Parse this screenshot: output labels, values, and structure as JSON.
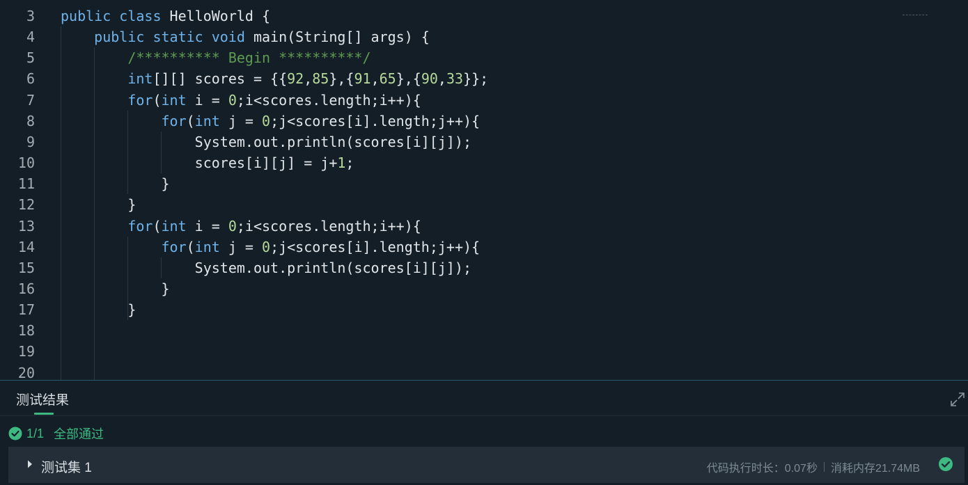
{
  "editor": {
    "lines": [
      {
        "number": "3",
        "segments": [
          {
            "k": "kw",
            "t": "public"
          },
          {
            "k": "",
            "t": " "
          },
          {
            "k": "kw",
            "t": "class"
          },
          {
            "k": "",
            "t": " HelloWorld {"
          }
        ]
      },
      {
        "number": "4",
        "segments": [
          {
            "k": "",
            "t": "    "
          },
          {
            "k": "kw",
            "t": "public"
          },
          {
            "k": "",
            "t": " "
          },
          {
            "k": "kw",
            "t": "static"
          },
          {
            "k": "",
            "t": " "
          },
          {
            "k": "kw",
            "t": "void"
          },
          {
            "k": "",
            "t": " main(String[] args) {"
          }
        ]
      },
      {
        "number": "5",
        "segments": [
          {
            "k": "",
            "t": "        "
          },
          {
            "k": "cm",
            "t": "/********** Begin **********/"
          }
        ]
      },
      {
        "number": "6",
        "segments": [
          {
            "k": "",
            "t": "        "
          },
          {
            "k": "kw",
            "t": "int"
          },
          {
            "k": "",
            "t": "[][] scores = {{"
          },
          {
            "k": "num",
            "t": "92"
          },
          {
            "k": "",
            "t": ","
          },
          {
            "k": "num",
            "t": "85"
          },
          {
            "k": "",
            "t": "},{"
          },
          {
            "k": "num",
            "t": "91"
          },
          {
            "k": "",
            "t": ","
          },
          {
            "k": "num",
            "t": "65"
          },
          {
            "k": "",
            "t": "},{"
          },
          {
            "k": "num",
            "t": "90"
          },
          {
            "k": "",
            "t": ","
          },
          {
            "k": "num",
            "t": "33"
          },
          {
            "k": "",
            "t": "}};"
          }
        ]
      },
      {
        "number": "7",
        "segments": [
          {
            "k": "",
            "t": "        "
          },
          {
            "k": "kw",
            "t": "for"
          },
          {
            "k": "",
            "t": "("
          },
          {
            "k": "kw",
            "t": "int"
          },
          {
            "k": "",
            "t": " i = "
          },
          {
            "k": "num",
            "t": "0"
          },
          {
            "k": "",
            "t": ";i<scores.length;i++){"
          }
        ]
      },
      {
        "number": "8",
        "segments": [
          {
            "k": "",
            "t": "            "
          },
          {
            "k": "kw",
            "t": "for"
          },
          {
            "k": "",
            "t": "("
          },
          {
            "k": "kw",
            "t": "int"
          },
          {
            "k": "",
            "t": " j = "
          },
          {
            "k": "num",
            "t": "0"
          },
          {
            "k": "",
            "t": ";j<scores[i].length;j++){"
          }
        ]
      },
      {
        "number": "9",
        "segments": [
          {
            "k": "",
            "t": "                System.out.println(scores[i][j]);"
          }
        ]
      },
      {
        "number": "10",
        "segments": [
          {
            "k": "",
            "t": "                scores[i][j] = j+"
          },
          {
            "k": "num",
            "t": "1"
          },
          {
            "k": "",
            "t": ";"
          }
        ]
      },
      {
        "number": "11",
        "segments": [
          {
            "k": "",
            "t": "            }"
          }
        ]
      },
      {
        "number": "12",
        "segments": [
          {
            "k": "",
            "t": "        }"
          }
        ]
      },
      {
        "number": "13",
        "segments": [
          {
            "k": "",
            "t": "        "
          },
          {
            "k": "kw",
            "t": "for"
          },
          {
            "k": "",
            "t": "("
          },
          {
            "k": "kw",
            "t": "int"
          },
          {
            "k": "",
            "t": " i = "
          },
          {
            "k": "num",
            "t": "0"
          },
          {
            "k": "",
            "t": ";i<scores.length;i++){"
          }
        ]
      },
      {
        "number": "14",
        "segments": [
          {
            "k": "",
            "t": "            "
          },
          {
            "k": "kw",
            "t": "for"
          },
          {
            "k": "",
            "t": "("
          },
          {
            "k": "kw",
            "t": "int"
          },
          {
            "k": "",
            "t": " j = "
          },
          {
            "k": "num",
            "t": "0"
          },
          {
            "k": "",
            "t": ";j<scores[i].length;j++){"
          }
        ]
      },
      {
        "number": "15",
        "segments": [
          {
            "k": "",
            "t": "                System.out.println(scores[i][j]);"
          }
        ]
      },
      {
        "number": "16",
        "segments": [
          {
            "k": "",
            "t": "            }"
          }
        ]
      },
      {
        "number": "17",
        "segments": [
          {
            "k": "",
            "t": "        }"
          }
        ]
      },
      {
        "number": "18",
        "segments": []
      },
      {
        "number": "19",
        "segments": []
      },
      {
        "number": "20",
        "segments": []
      }
    ]
  },
  "results": {
    "tab_label": "测试结果",
    "summary": {
      "count": "1/1",
      "label": "全部通过"
    },
    "testset": {
      "label": "测试集 1",
      "exec_time": "代码执行时长：0.07秒",
      "memory": "消耗内存21.74MB"
    }
  },
  "colors": {
    "background": "#141e26",
    "keyword": "#6fb3ea",
    "comment": "#5e9a52",
    "number": "#b8d99c",
    "success": "#3dba82"
  },
  "icons": {
    "expand": "expand-icon",
    "pass_check": "check-circle-icon",
    "caret": "caret-right-icon"
  }
}
